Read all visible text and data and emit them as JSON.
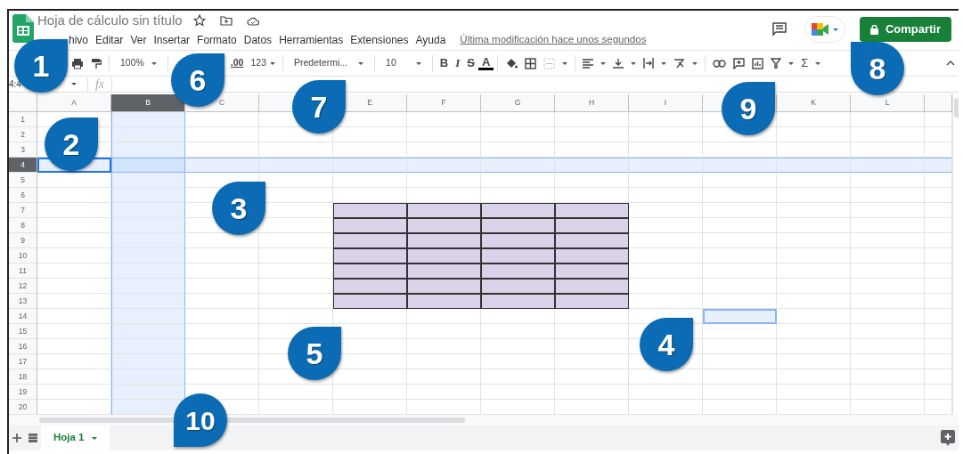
{
  "app": {
    "title": "Hoja de cálculo sin título",
    "last_edit": "Última modificación hace unos segundos",
    "share_button": "Compartir"
  },
  "menu": [
    "hivo",
    "Editar",
    "Ver",
    "Insertar",
    "Formato",
    "Datos",
    "Herramientas",
    "Extensiones",
    "Ayuda"
  ],
  "toolbar": {
    "zoom": "100%",
    "decimals": ".00",
    "number_format": "123",
    "font": "Predetermi...",
    "font_size": "10",
    "bold": "B",
    "italic": "I",
    "strike": "S",
    "text_color": "A",
    "sum": "Σ"
  },
  "formula_bar": {
    "name_box": "4:4",
    "fx": "fx"
  },
  "columns": [
    {
      "label": "A",
      "selected": false,
      "cursor": true,
      "shaded": false,
      "outlined": false
    },
    {
      "label": "B",
      "selected": true,
      "cursor": false,
      "shaded": false,
      "outlined": false
    },
    {
      "label": "C",
      "selected": false,
      "cursor": false,
      "shaded": false,
      "outlined": false
    },
    {
      "selected": false,
      "cursor": false,
      "shaded": false,
      "outlined": false
    },
    {
      "label": "E",
      "selected": false,
      "cursor": false,
      "shaded": true,
      "outlined": false
    },
    {
      "label": "F",
      "selected": false,
      "cursor": false,
      "shaded": true,
      "outlined": false
    },
    {
      "label": "G",
      "selected": false,
      "cursor": false,
      "shaded": true,
      "outlined": false
    },
    {
      "label": "H",
      "selected": false,
      "cursor": false,
      "shaded": true,
      "outlined": false
    },
    {
      "label": "I",
      "selected": false,
      "cursor": false,
      "shaded": false,
      "outlined": false
    },
    {
      "selected": false,
      "cursor": false,
      "shaded": false,
      "outlined": true
    },
    {
      "label": "K",
      "selected": false,
      "cursor": false,
      "shaded": false,
      "outlined": false
    },
    {
      "label": "L",
      "selected": false,
      "cursor": false,
      "shaded": false,
      "outlined": false
    }
  ],
  "rows": [
    {
      "label": "1",
      "selected": false,
      "cursor": false,
      "shaded": false,
      "outlined": false
    },
    {
      "label": "2",
      "selected": false,
      "cursor": false,
      "shaded": false,
      "outlined": false
    },
    {
      "label": "3",
      "selected": false,
      "cursor": false,
      "shaded": false,
      "outlined": false
    },
    {
      "label": "4",
      "selected": true,
      "cursor": true,
      "shaded": false,
      "outlined": false
    },
    {
      "label": "5",
      "selected": false,
      "cursor": false,
      "shaded": false,
      "outlined": false
    },
    {
      "label": "6",
      "selected": false,
      "cursor": false,
      "shaded": false,
      "outlined": false
    },
    {
      "label": "7",
      "selected": false,
      "cursor": false,
      "shaded": true,
      "outlined": false
    },
    {
      "label": "8",
      "selected": false,
      "cursor": false,
      "shaded": true,
      "outlined": false
    },
    {
      "label": "9",
      "selected": false,
      "cursor": false,
      "shaded": true,
      "outlined": false
    },
    {
      "label": "10",
      "selected": false,
      "cursor": false,
      "shaded": true,
      "outlined": false
    },
    {
      "label": "11",
      "selected": false,
      "cursor": false,
      "shaded": true,
      "outlined": false
    },
    {
      "label": "12",
      "selected": false,
      "cursor": false,
      "shaded": true,
      "outlined": false
    },
    {
      "label": "13",
      "selected": false,
      "cursor": false,
      "shaded": true,
      "outlined": false
    },
    {
      "label": "14",
      "selected": false,
      "cursor": false,
      "shaded": false,
      "outlined": true
    },
    {
      "label": "15",
      "selected": false,
      "cursor": false,
      "shaded": false,
      "outlined": false
    },
    {
      "label": "16",
      "selected": false,
      "cursor": false,
      "shaded": false,
      "outlined": false
    },
    {
      "label": "17",
      "selected": false,
      "cursor": false,
      "shaded": false,
      "outlined": false
    },
    {
      "label": "18",
      "selected": false,
      "cursor": false,
      "shaded": false,
      "outlined": false
    },
    {
      "label": "19",
      "selected": false,
      "cursor": false,
      "shaded": false,
      "outlined": false
    },
    {
      "label": "20",
      "selected": false,
      "cursor": false,
      "shaded": false,
      "outlined": false
    }
  ],
  "sheet_tabs": [
    {
      "label": "Hoja 1",
      "selected": true
    }
  ],
  "callouts": [
    "1",
    "2",
    "3",
    "4",
    "5",
    "6",
    "7",
    "8",
    "9",
    "10"
  ]
}
